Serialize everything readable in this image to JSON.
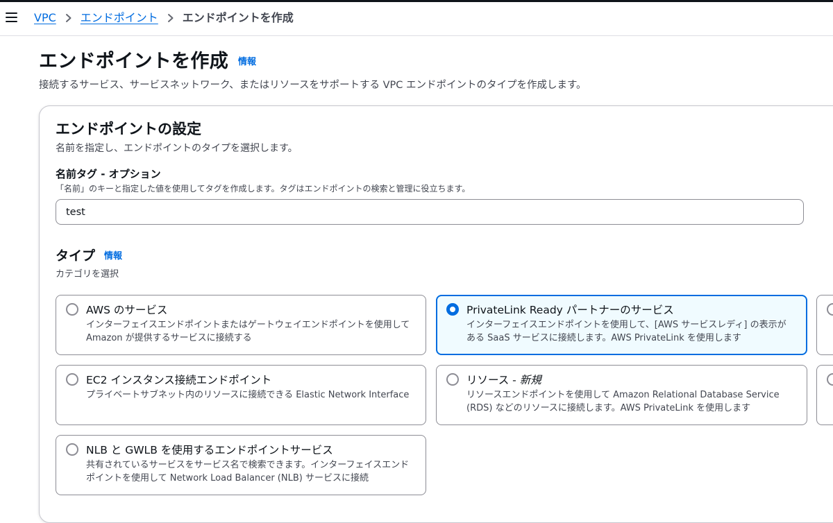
{
  "header": {
    "breadcrumb": {
      "items": [
        "VPC",
        "エンドポイント"
      ],
      "current": "エンドポイントを作成"
    }
  },
  "page": {
    "title": "エンドポイントを作成",
    "info_label": "情報",
    "description": "接続するサービス、サービスネットワーク、またはリソースをサポートする VPC エンドポイントのタイプを作成します。"
  },
  "settings": {
    "title": "エンドポイントの設定",
    "description": "名前を指定し、エンドポイントのタイプを選択します。",
    "name_tag": {
      "label": "名前タグ - オプション",
      "description": "「名前」のキーと指定した値を使用してタグを作成します。タグはエンドポイントの検索と管理に役立ちます。",
      "value": "test"
    }
  },
  "type": {
    "title": "タイプ",
    "info_label": "情報",
    "description": "カテゴリを選択",
    "options": [
      {
        "title": "AWS のサービス",
        "description": "インターフェイスエンドポイントまたはゲートウェイエンドポイントを使用して Amazon が提供するサービスに接続する"
      },
      {
        "title": "PrivateLink Ready パートナーのサービス",
        "description": "インターフェイスエンドポイントを使用して、[AWS サービスレディ] の表示がある SaaS サービスに接続します。AWS PrivateLink を使用します"
      },
      {
        "title": "EC2 インスタンス接続エンドポイント",
        "description": "プライベートサブネット内のリソースに接続できる Elastic Network Interface"
      },
      {
        "title_main": "リソース - ",
        "title_em": "新規",
        "description": "リソースエンドポイントを使用して Amazon Relational Database Service (RDS) などのリソースに接続します。AWS PrivateLink を使用します"
      },
      {
        "title": "NLB と GWLB を使用するエンドポイントサービス",
        "description": "共有されているサービスをサービス名で検索できます。インターフェイスエンドポイントを使用して Network Load Balancer (NLB) サービスに接続"
      }
    ],
    "selected_index": 1
  },
  "colors": {
    "accent": "#006ce0",
    "selected_bg": "#f0fbff",
    "text": "#0f141a",
    "secondary_text": "#424650",
    "border": "#8c8c94"
  }
}
